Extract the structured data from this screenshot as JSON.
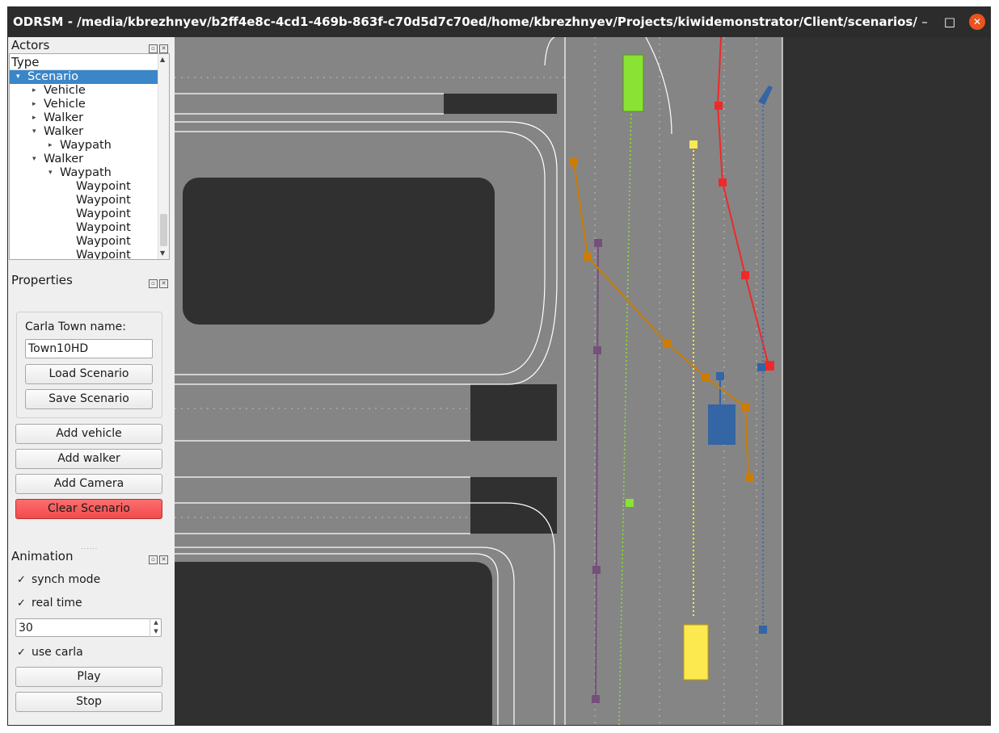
{
  "window": {
    "title": "ODRSM - /media/kbrezhnyev/b2ff4e8c-4cd1-469b-863f-c70d5d7c70ed/home/kbrezhnyev/Projects/kiwidemonstrator/Client/scenarios/benchmarking/OSRS...",
    "minimize": "–",
    "maximize": "□",
    "close": "✕"
  },
  "actors": {
    "title": "Actors",
    "column": "Type",
    "tree": [
      {
        "label": "Scenario",
        "arrow": "▾",
        "selected": true
      },
      {
        "label": "Vehicle",
        "arrow": "▸"
      },
      {
        "label": "Vehicle",
        "arrow": "▸"
      },
      {
        "label": "Walker",
        "arrow": "▸"
      },
      {
        "label": "Walker",
        "arrow": "▾"
      },
      {
        "label": "Waypath",
        "arrow": "▸"
      },
      {
        "label": "Walker",
        "arrow": "▾"
      },
      {
        "label": "Waypath",
        "arrow": "▾"
      },
      {
        "label": "Waypoint",
        "arrow": ""
      },
      {
        "label": "Waypoint",
        "arrow": ""
      },
      {
        "label": "Waypoint",
        "arrow": ""
      },
      {
        "label": "Waypoint",
        "arrow": ""
      },
      {
        "label": "Waypoint",
        "arrow": ""
      },
      {
        "label": "Waypoint",
        "arrow": ""
      }
    ]
  },
  "properties": {
    "title": "Properties",
    "town_label": "Carla Town name:",
    "town_value": "Town10HD",
    "load": "Load Scenario",
    "save": "Save Scenario",
    "add_vehicle": "Add vehicle",
    "add_walker": "Add walker",
    "add_camera": "Add Camera",
    "clear": "Clear Scenario"
  },
  "animation": {
    "title": "Animation",
    "synch_mode": "synch mode",
    "synch_checked": "✓",
    "real_time": "real time",
    "real_checked": "✓",
    "fps": "30",
    "use_carla": "use carla",
    "carla_checked": "✓",
    "play": "Play",
    "stop": "Stop"
  },
  "colors": {
    "road": "#858585",
    "background": "#303030",
    "vehicle_green": "#8ae234",
    "vehicle_yellow": "#fce94f",
    "vehicle_blue": "#3465a4",
    "walker_red": "#ef2929",
    "walker_orange": "#ce7c00",
    "walker_purple": "#75507b",
    "clear_button": "#f24b4b"
  }
}
